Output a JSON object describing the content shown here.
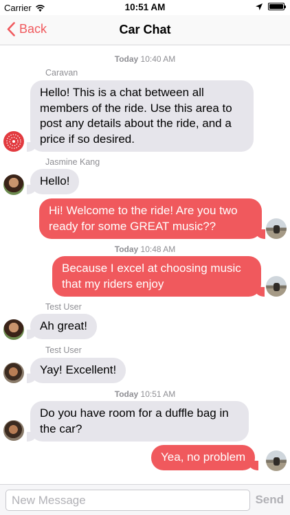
{
  "status_bar": {
    "carrier": "Carrier",
    "time": "10:51 AM"
  },
  "nav": {
    "back_label": "Back",
    "title": "Car Chat"
  },
  "timestamps": [
    {
      "day": "Today",
      "time": "10:40 AM"
    },
    {
      "day": "Today",
      "time": "10:48 AM"
    },
    {
      "day": "Today",
      "time": "10:51 AM"
    }
  ],
  "senders": [
    "Caravan",
    "Jasmine Kang",
    "Test User",
    "Test User"
  ],
  "messages": [
    {
      "direction": "incoming",
      "text": "Hello! This is a chat between all members of the ride. Use this area to post any details about the ride, and a price if so desired."
    },
    {
      "direction": "incoming",
      "text": "Hello!"
    },
    {
      "direction": "outgoing",
      "text": "Hi! Welcome to the ride! Are you two ready for some GREAT music??"
    },
    {
      "direction": "outgoing",
      "text": "Because I excel at choosing music that my riders enjoy"
    },
    {
      "direction": "incoming",
      "text": "Ah great!"
    },
    {
      "direction": "incoming",
      "text": "Yay! Excellent!"
    },
    {
      "direction": "incoming",
      "text": "Do you have room for a duffle bag in the car?"
    },
    {
      "direction": "outgoing",
      "text": "Yea, no problem"
    }
  ],
  "input": {
    "placeholder": "New Message",
    "value": "",
    "send_label": "Send"
  },
  "colors": {
    "accent": "#f0595d",
    "incoming_bubble": "#e6e5eb",
    "meta_text": "#8e8e93",
    "disabled": "#b1b1b6"
  }
}
